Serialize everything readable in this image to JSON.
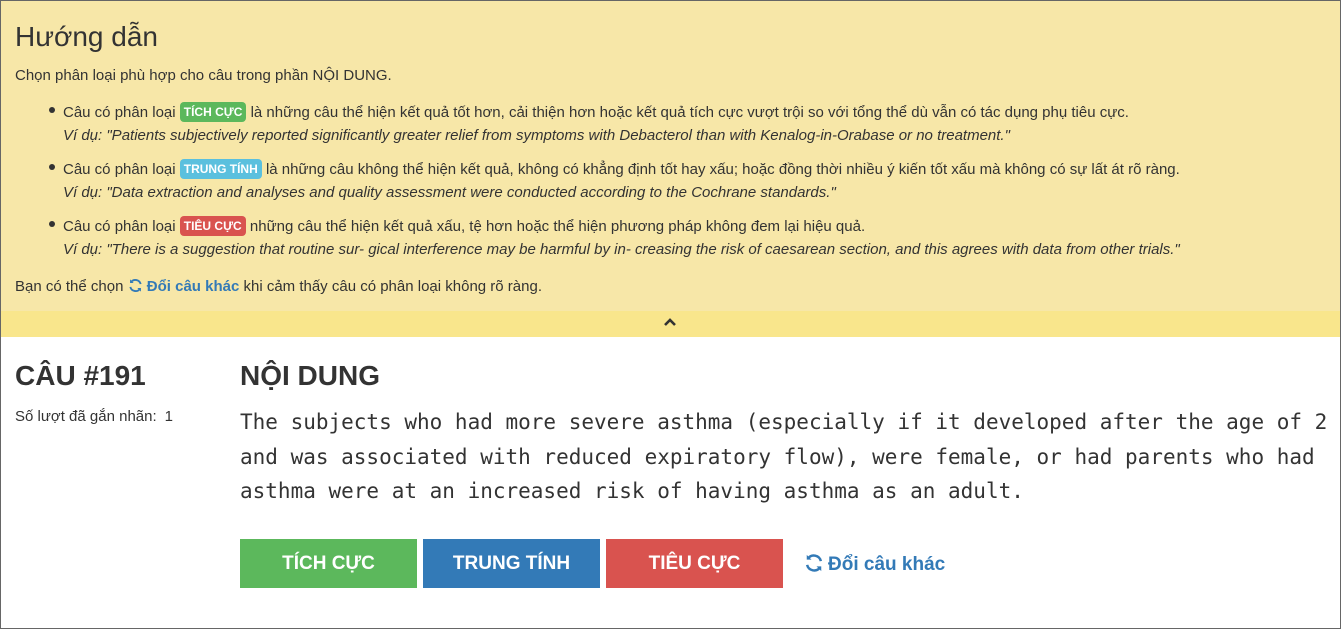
{
  "guide": {
    "title": "Hướng dẫn",
    "intro": "Chọn phân loại phù hợp cho câu trong phần NỘI DUNG.",
    "items": [
      {
        "prefix": "Câu có phân loại",
        "badge": "TÍCH CỰC",
        "text": "là những câu thể hiện kết quả tốt hơn, cải thiện hơn hoặc kết quả tích cực vượt trội so với tổng thể dù vẫn có tác dụng phụ tiêu cực.",
        "example": "Ví dụ: \"Patients subjectively reported significantly greater relief from symptoms with Debacterol than with Kenalog-in-Orabase or no treatment.\""
      },
      {
        "prefix": "Câu có phân loại",
        "badge": "TRUNG TÍNH",
        "text": "là những câu không thể hiện kết quả, không có khẳng định tốt hay xấu; hoặc đồng thời nhiều ý kiến tốt xấu mà không có sự lất át rõ ràng.",
        "example": "Ví dụ: \"Data extraction and analyses and quality assessment were conducted according to the Cochrane standards.\""
      },
      {
        "prefix": "Câu có phân loại",
        "badge": "TIÊU CỰC",
        "text": "những câu thể hiện kết quả xấu, tệ hơn hoặc thể hiện phương pháp không đem lại hiệu quả.",
        "example": "Ví dụ: \"There is a suggestion that routine sur- gical interference may be harmful by in- creasing the risk of caesarean section, and this agrees with data from other trials.\""
      }
    ],
    "footer_prefix": "Bạn có thể chọn",
    "footer_link": "Đổi câu khác",
    "footer_suffix": "khi cảm thấy câu có phân loại không rõ ràng."
  },
  "question": {
    "number": "CÂU #191",
    "count_label": "Số lượt đã gắn nhãn:",
    "count_value": "1"
  },
  "content": {
    "title": "NỘI DUNG",
    "text": "The subjects who had more severe asthma (especially if it developed after the age of 2 and was associated with reduced expiratory flow), were female, or had parents who had asthma were at an increased risk of having asthma as an adult."
  },
  "actions": {
    "positive": "TÍCH CỰC",
    "neutral": "TRUNG TÍNH",
    "negative": "TIÊU CỰC",
    "swap": "Đổi câu khác"
  },
  "colors": {
    "guide_bg": "#f7e7a8",
    "positive": "#5cb85c",
    "neutral_badge": "#5bc0de",
    "neutral_button": "#337ab7",
    "negative": "#d9534f",
    "link": "#337ab7"
  },
  "icons": {
    "refresh": "refresh-icon",
    "collapse": "chevron-up-icon"
  }
}
